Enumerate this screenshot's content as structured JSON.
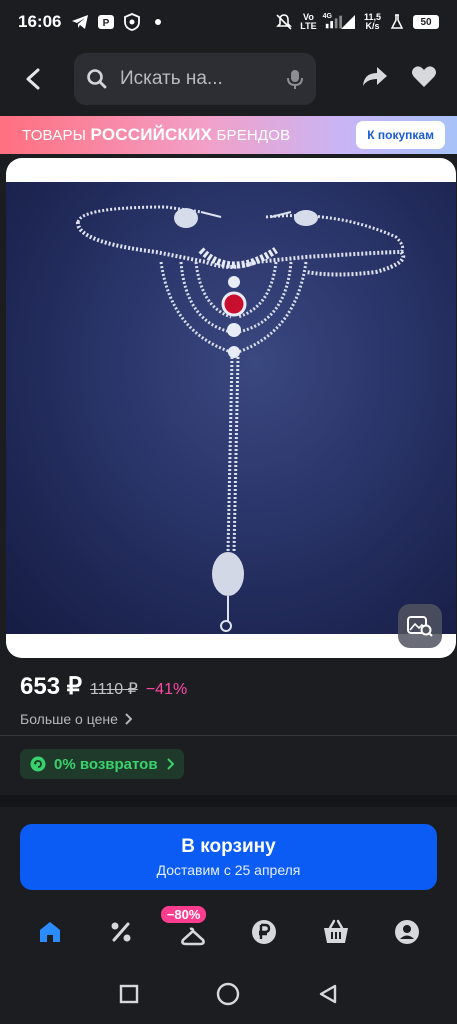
{
  "status_bar": {
    "time": "16:06",
    "network_type": "Vo\nLTE",
    "net_gen": "4G",
    "speed": "11,5\nK/s",
    "battery": "50"
  },
  "top_nav": {
    "search_placeholder": "Искать на..."
  },
  "banner": {
    "text_prefix": "ТОВАРЫ ",
    "text_bold": "РОССИЙСКИХ",
    "text_suffix": " БРЕНДОВ",
    "button_label": "К покупкам"
  },
  "product": {
    "price": "653 ₽",
    "old_price": "1110 ₽",
    "discount": "−41%",
    "more_price_label": "Больше о цене",
    "returns_badge": "0% возвратов"
  },
  "cart": {
    "label": "В корзину",
    "delivery": "Доставим с 25 апреля"
  },
  "bottom_tabs": {
    "promo_badge": "−80%",
    "items": [
      "home-icon",
      "percent-icon",
      "fashion-icon",
      "ruble-icon",
      "basket-icon",
      "profile-icon"
    ]
  },
  "colors": {
    "background": "#1c1d21",
    "accent_blue": "#0b5cf5",
    "discount_pink": "#ff4aa6",
    "returns_green": "#39d36d"
  }
}
